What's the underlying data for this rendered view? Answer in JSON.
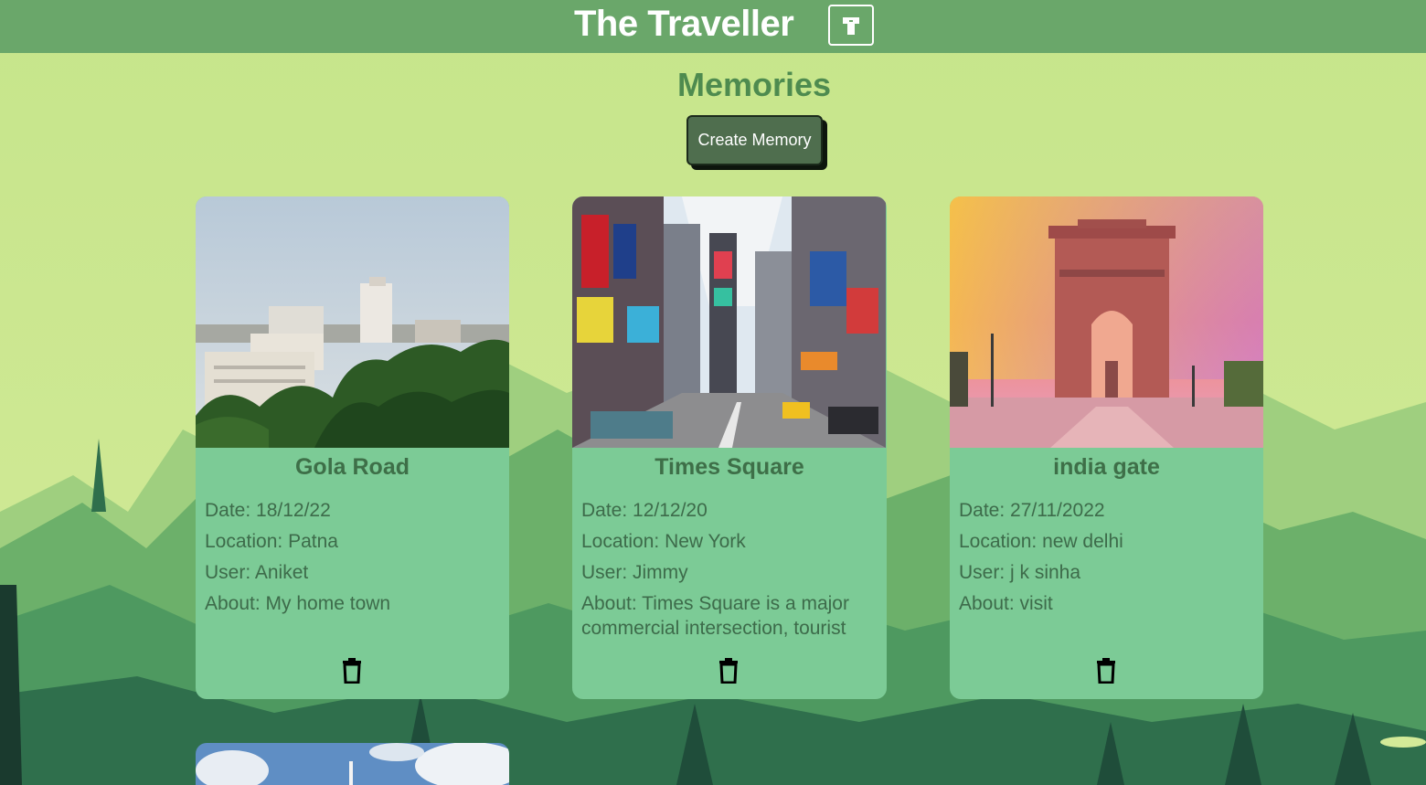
{
  "navbar": {
    "brand": "The Traveller",
    "menu_icon": "tower-icon"
  },
  "page": {
    "title": "Memories",
    "create_label": "Create Memory"
  },
  "labels": {
    "date": "Date: ",
    "location": "Location: ",
    "user": "User: ",
    "about": "About: "
  },
  "memories": [
    {
      "title": "Gola Road",
      "date": "Date: 18/12/22",
      "location": "Location: Patna",
      "user": "User: Aniket",
      "about": "About: My home town",
      "image": "city-skyline-photo"
    },
    {
      "title": "Times Square",
      "date": "Date: 12/12/20",
      "location": "Location: New York",
      "user": "User: Jimmy",
      "about": "About: Times Square is a major commercial intersection, tourist",
      "image": "times-square-photo"
    },
    {
      "title": "india gate",
      "date": "Date: 27/11/2022",
      "location": "Location: new delhi",
      "user": "User: j k sinha",
      "about": "About: visit",
      "image": "india-gate-photo"
    }
  ],
  "colors": {
    "navbar": "#6aa76a",
    "background": "#c9e68f",
    "card": "#7ccb96",
    "title": "#4e8b4f",
    "button": "#4f6e4e"
  }
}
